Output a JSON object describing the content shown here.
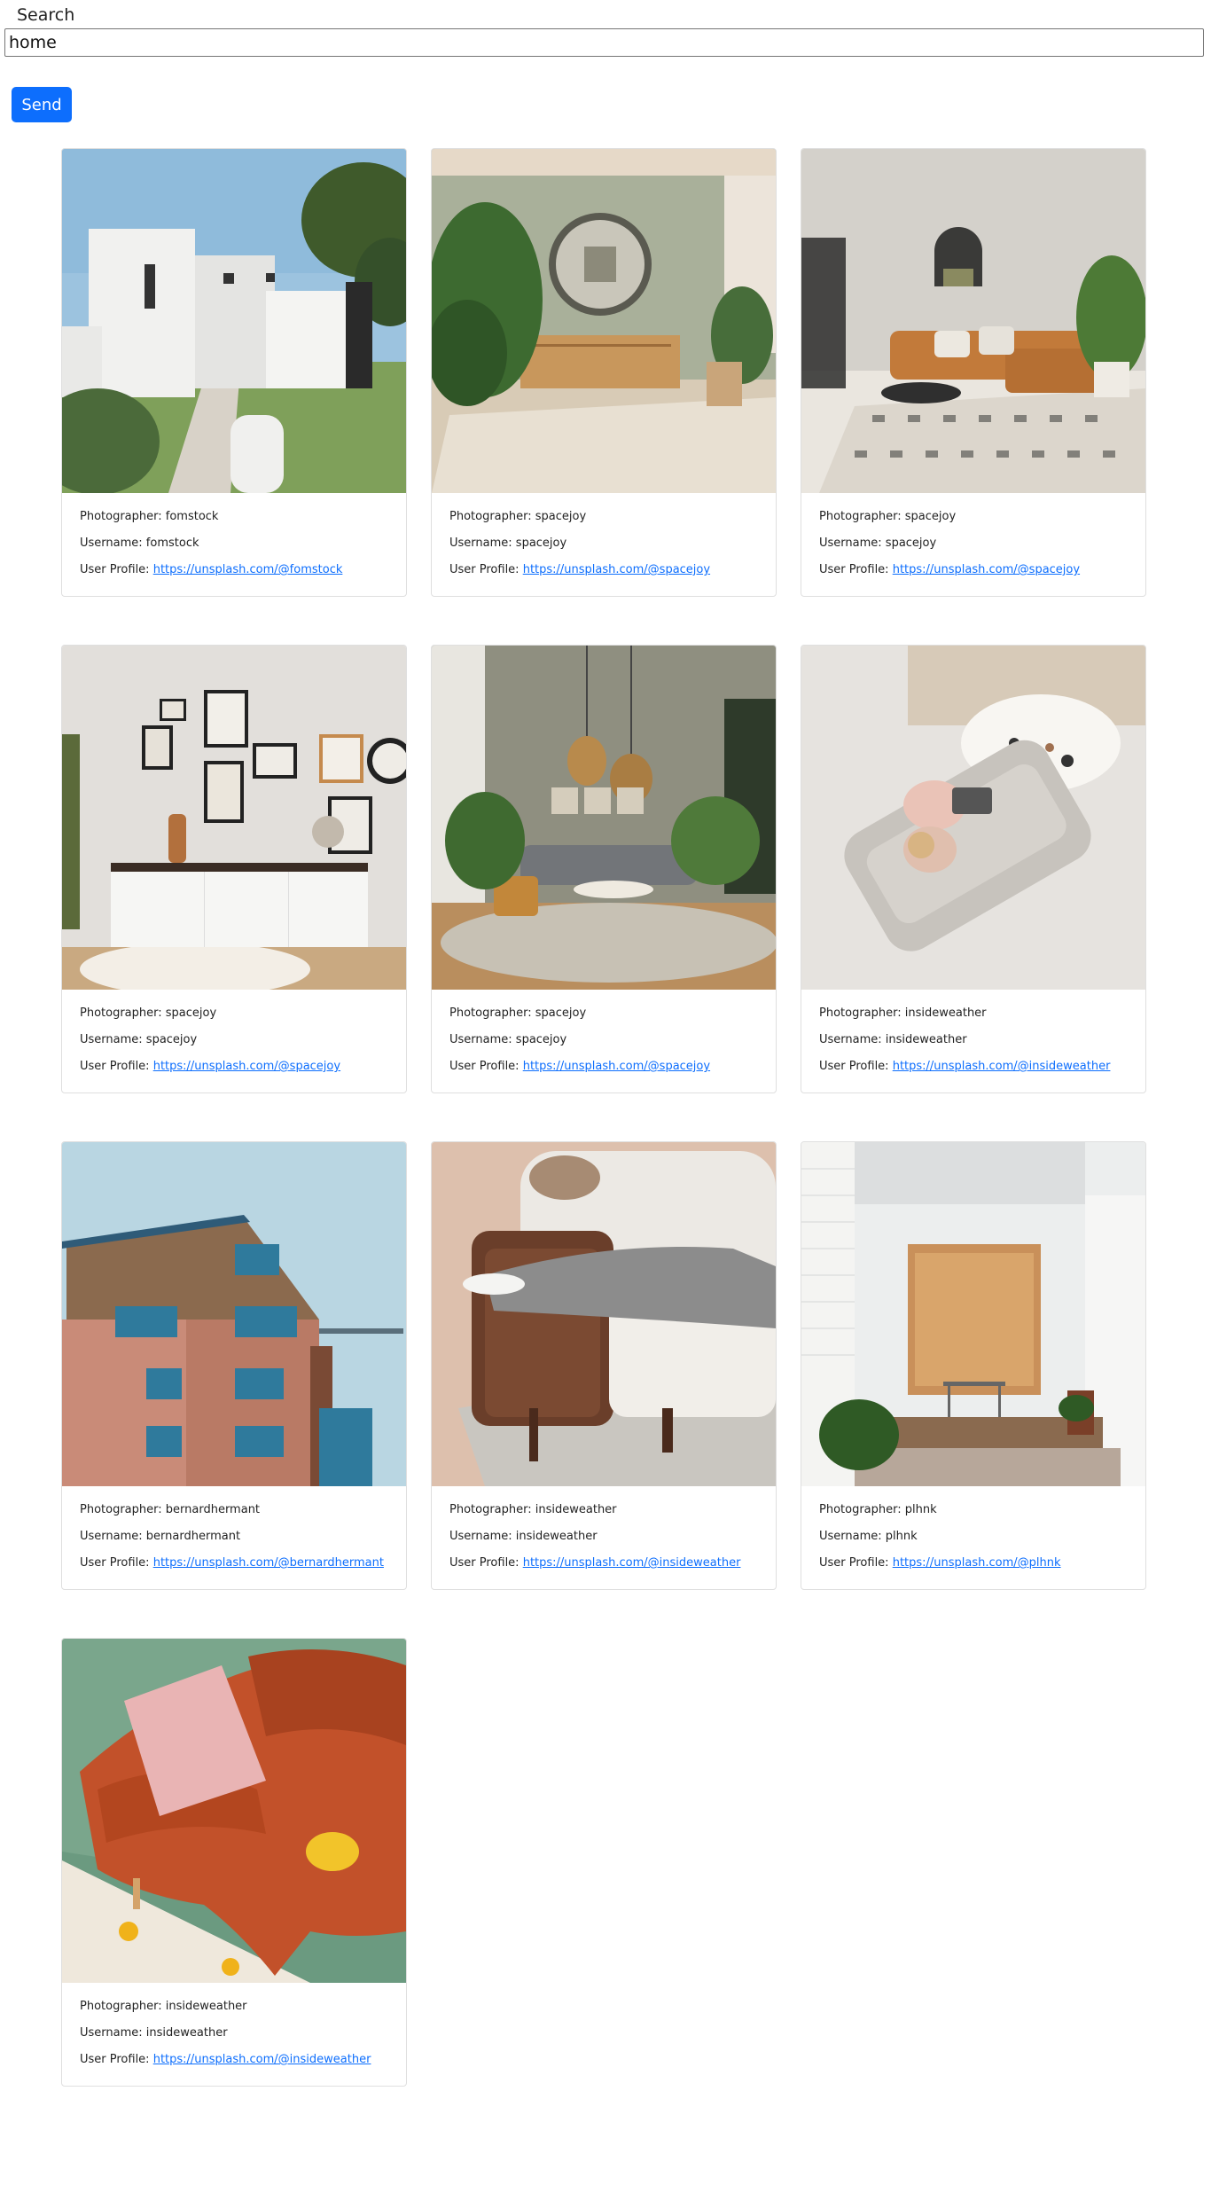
{
  "search": {
    "label": "Search",
    "value": "home",
    "button": "Send"
  },
  "labels": {
    "photographer": "Photographer: ",
    "username": "Username: ",
    "profile": "User Profile: "
  },
  "colors": {
    "primary": "#0d6efd",
    "card_border": "#dfdfdf"
  },
  "results": [
    {
      "photographer": "fomstock",
      "username": "fomstock",
      "profile": "https://unsplash.com/@fomstock",
      "image": "white-modern-house"
    },
    {
      "photographer": "spacejoy",
      "username": "spacejoy",
      "profile": "https://unsplash.com/@spacejoy",
      "image": "living-room-round-mirror"
    },
    {
      "photographer": "spacejoy",
      "username": "spacejoy",
      "profile": "https://unsplash.com/@spacejoy",
      "image": "living-room-orange-sofa"
    },
    {
      "photographer": "spacejoy",
      "username": "spacejoy",
      "profile": "https://unsplash.com/@spacejoy",
      "image": "gallery-wall-sideboard"
    },
    {
      "photographer": "spacejoy",
      "username": "spacejoy",
      "profile": "https://unsplash.com/@spacejoy",
      "image": "living-room-pendant-lamps"
    },
    {
      "photographer": "insideweather",
      "username": "insideweather",
      "profile": "https://unsplash.com/@insideweather",
      "image": "woman-on-sofa-top-view"
    },
    {
      "photographer": "bernardhermant",
      "username": "bernardhermant",
      "profile": "https://unsplash.com/@bernardhermant",
      "image": "brick-wood-building"
    },
    {
      "photographer": "insideweather",
      "username": "insideweather",
      "profile": "https://unsplash.com/@insideweather",
      "image": "person-on-armchair"
    },
    {
      "photographer": "plhnk",
      "username": "plhnk",
      "profile": "https://unsplash.com/@plhnk",
      "image": "white-porch-wood-panel"
    },
    {
      "photographer": "insideweather",
      "username": "insideweather",
      "profile": "https://unsplash.com/@insideweather",
      "image": "orange-sofa-lemons"
    }
  ]
}
